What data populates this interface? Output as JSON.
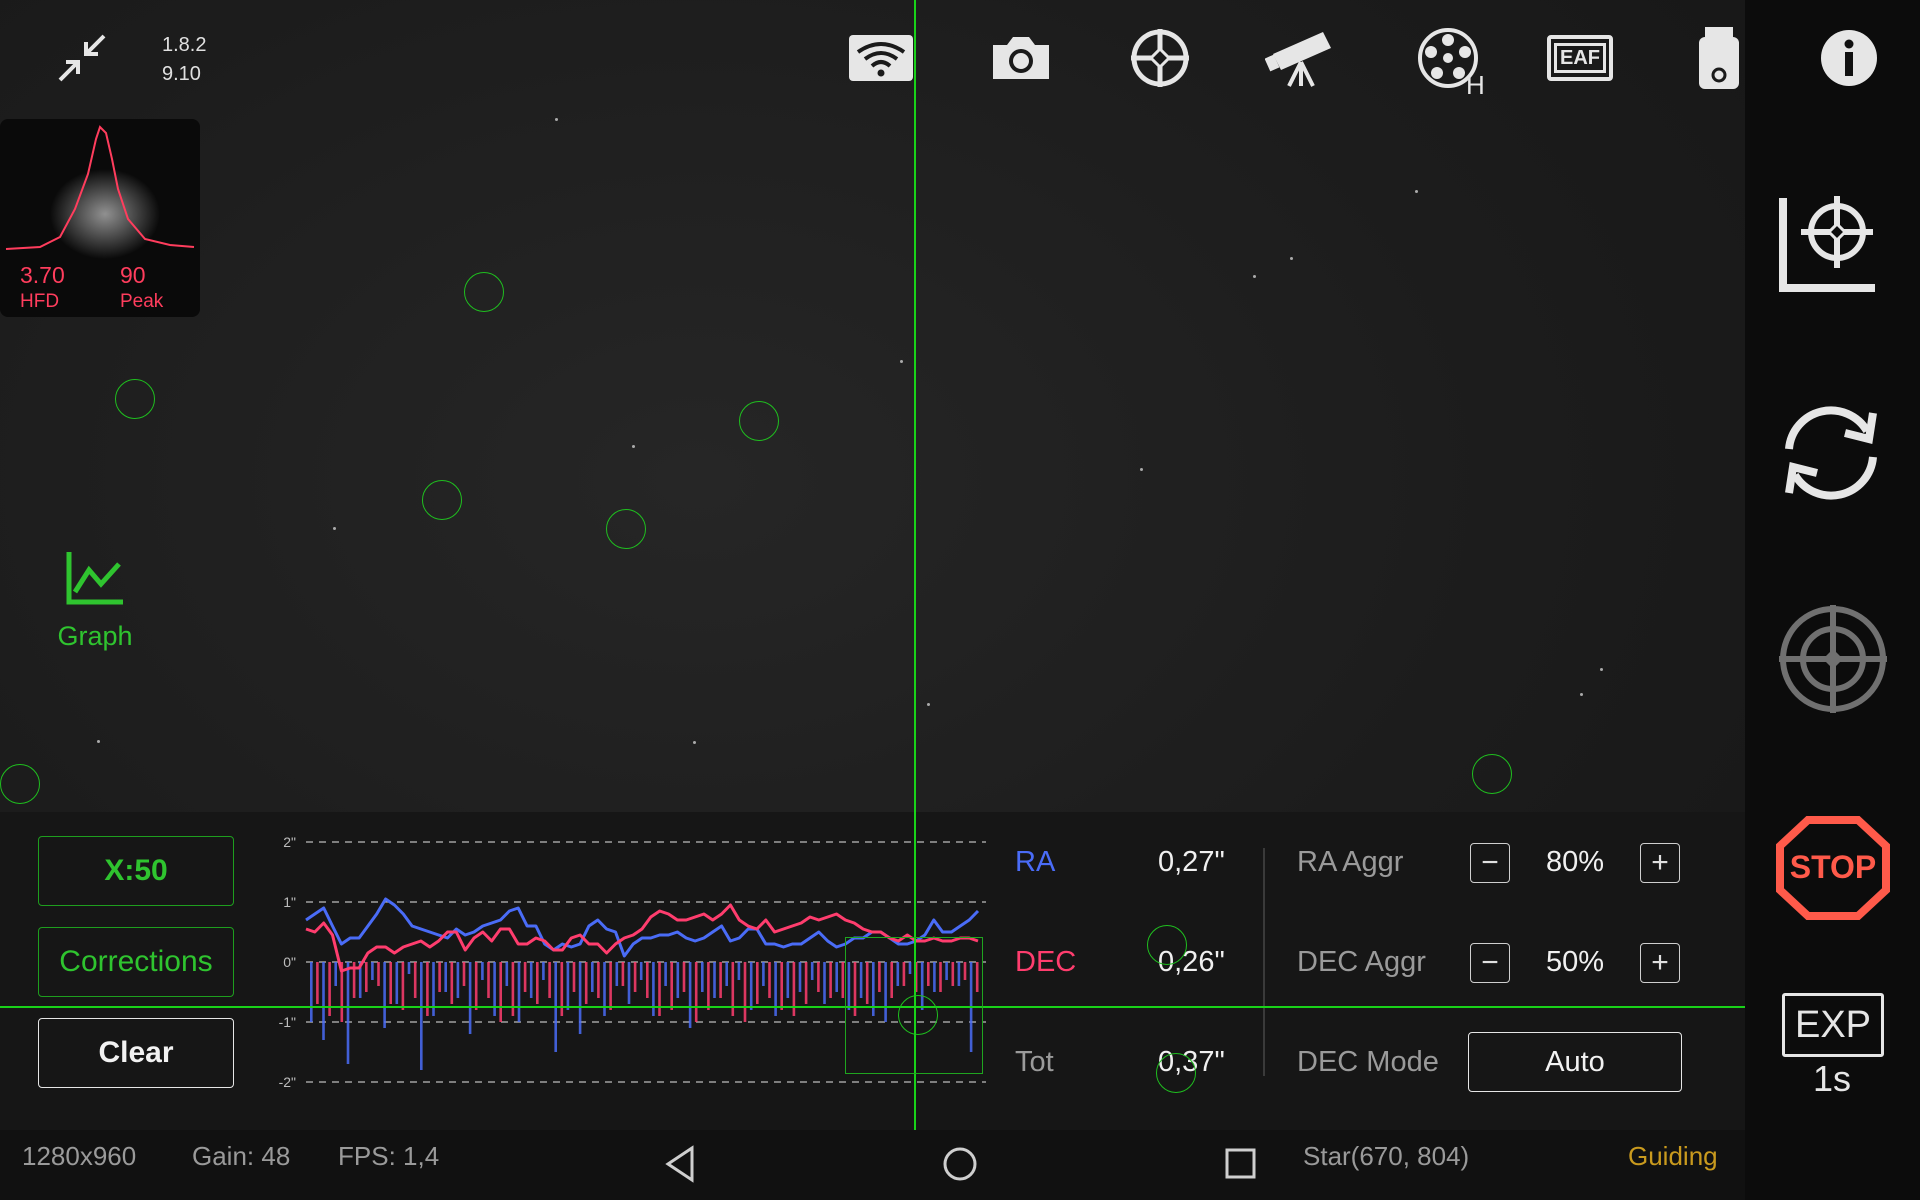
{
  "header": {
    "version_app": "1.8.2",
    "version_sys": "9.10",
    "filter_wheel_badge": "H",
    "icons": [
      "collapse-icon",
      "wifi-icon",
      "camera-icon",
      "target-icon",
      "telescope-icon",
      "filter-wheel-icon",
      "eaf-icon",
      "usb-drive-icon",
      "info-icon"
    ],
    "eaf_label": "EAF"
  },
  "star_profile": {
    "hfd_value": "3.70",
    "hfd_label": "HFD",
    "peak_value": "90",
    "peak_label": "Peak"
  },
  "graph_button": {
    "label": "Graph"
  },
  "guide_panel": {
    "scale_button": "X:50",
    "corrections_button": "Corrections",
    "clear_button": "Clear",
    "y_ticks": [
      "2\"",
      "1\"",
      "0\"",
      "-1\"",
      "-2\""
    ],
    "ra_label": "RA",
    "ra_value": "0,27\"",
    "dec_label": "DEC",
    "dec_value": "0,26\"",
    "tot_label": "Tot",
    "tot_value": "0,37\"",
    "ra_aggr_label": "RA Aggr",
    "ra_aggr_value": "80%",
    "dec_aggr_label": "DEC Aggr",
    "dec_aggr_value": "50%",
    "dec_mode_label": "DEC Mode",
    "dec_mode_value": "Auto",
    "minus_symbol": "−",
    "plus_symbol": "+"
  },
  "chart_data": {
    "type": "line",
    "ylim": [
      -2,
      2
    ],
    "yticks": [
      "2\"",
      "1\"",
      "0\"",
      "-1\"",
      "-2\""
    ],
    "series": [
      {
        "name": "RA",
        "color": "#4a6cf7",
        "values": [
          0.7,
          0.8,
          0.9,
          0.6,
          0.3,
          0.4,
          0.4,
          0.6,
          0.8,
          1.05,
          0.95,
          0.8,
          0.6,
          0.55,
          0.5,
          0.45,
          0.4,
          0.55,
          0.45,
          0.5,
          0.6,
          0.65,
          0.7,
          0.85,
          0.9,
          0.6,
          0.6,
          0.3,
          0.2,
          0.3,
          0.25,
          0.3,
          0.6,
          0.7,
          0.55,
          0.5,
          0.1,
          0.3,
          0.4,
          0.4,
          0.45,
          0.45,
          0.5,
          0.4,
          0.35,
          0.4,
          0.5,
          0.6,
          0.35,
          0.4,
          0.55,
          0.55,
          0.3,
          0.3,
          0.25,
          0.3,
          0.3,
          0.4,
          0.5,
          0.35,
          0.25,
          0.3,
          0.4,
          0.4,
          0.5,
          0.5,
          0.4,
          0.3,
          0.3,
          0.35,
          0.45,
          0.7,
          0.5,
          0.5,
          0.6,
          0.7,
          0.85
        ]
      },
      {
        "name": "DEC",
        "color": "#ff3d6e",
        "values": [
          0.55,
          0.5,
          0.65,
          0.45,
          -0.15,
          -0.1,
          -0.1,
          0.15,
          0.25,
          0.25,
          0.15,
          0.25,
          0.3,
          0.35,
          0.25,
          0.35,
          0.5,
          0.5,
          0.2,
          0.4,
          0.5,
          0.35,
          0.55,
          0.55,
          0.3,
          0.3,
          0.4,
          0.35,
          0.2,
          0.2,
          0.4,
          0.45,
          0.3,
          0.3,
          0.15,
          0.3,
          0.4,
          0.45,
          0.55,
          0.75,
          0.85,
          0.8,
          0.7,
          0.7,
          0.75,
          0.8,
          0.7,
          0.8,
          0.95,
          0.7,
          0.6,
          0.55,
          0.7,
          0.5,
          0.55,
          0.6,
          0.65,
          0.75,
          0.7,
          0.75,
          0.8,
          0.7,
          0.65,
          0.55,
          0.5,
          0.5,
          0.4,
          0.35,
          0.45,
          0.35,
          0.35,
          0.4,
          0.35,
          0.35,
          0.4,
          0.4,
          0.35
        ]
      }
    ],
    "correction_bars": {
      "RA": [
        -1.0,
        -1.3,
        -0.4,
        -1.7,
        -0.6,
        -0.3,
        -1.1,
        -0.7,
        -0.2,
        -1.8,
        -0.9,
        -0.5,
        -0.6,
        -1.2,
        -0.3,
        -0.9,
        -0.4,
        -1.0,
        -0.6,
        -0.3,
        -1.5,
        -0.8,
        -1.2,
        -0.5,
        -0.9,
        -0.4,
        -0.7,
        -0.3,
        -0.9,
        -0.4,
        -0.6,
        -1.1,
        -0.5,
        -0.6,
        -0.4,
        -0.3,
        -0.8,
        -0.4,
        -0.9,
        -0.6,
        -0.5,
        -0.3,
        -0.7,
        -0.5,
        -0.8,
        -0.6,
        -0.9,
        -1.0,
        -0.4,
        -0.2,
        -0.8,
        -0.5,
        -0.3,
        -0.4,
        -1.5
      ],
      "DEC": [
        -0.7,
        -0.9,
        -1.0,
        -0.6,
        -0.5,
        -0.4,
        -0.7,
        -0.8,
        -0.6,
        -0.9,
        -0.5,
        -0.7,
        -0.4,
        -0.8,
        -0.6,
        -1.0,
        -0.9,
        -0.5,
        -0.7,
        -0.6,
        -0.9,
        -0.5,
        -0.7,
        -0.6,
        -0.8,
        -0.4,
        -0.5,
        -0.6,
        -0.9,
        -0.8,
        -0.5,
        -1.0,
        -0.8,
        -0.6,
        -0.9,
        -1.0,
        -0.7,
        -0.6,
        -0.8,
        -0.9,
        -0.7,
        -0.5,
        -0.6,
        -0.6,
        -0.9,
        -0.7,
        -0.5,
        -0.6,
        -0.4,
        -0.5,
        -0.4,
        -0.5,
        -0.4,
        -0.3,
        -0.5
      ]
    }
  },
  "right_panel": {
    "icons": [
      "guide-calibrate-icon",
      "loop-icon",
      "guide-target-icon",
      "stop-icon"
    ],
    "stop_label": "STOP",
    "exp_label": "EXP",
    "exp_value": "1s"
  },
  "status_bar": {
    "resolution": "1280x960",
    "gain": "Gain: 48",
    "fps": "FPS: 1,4",
    "star": "Star(670, 804)",
    "state": "Guiding",
    "state_color": "#c99a1e"
  },
  "colors": {
    "accent_green": "#2fc42f",
    "ra_blue": "#4a6cf7",
    "dec_red": "#ff3d6e",
    "stop_red": "#ff5a4a"
  }
}
